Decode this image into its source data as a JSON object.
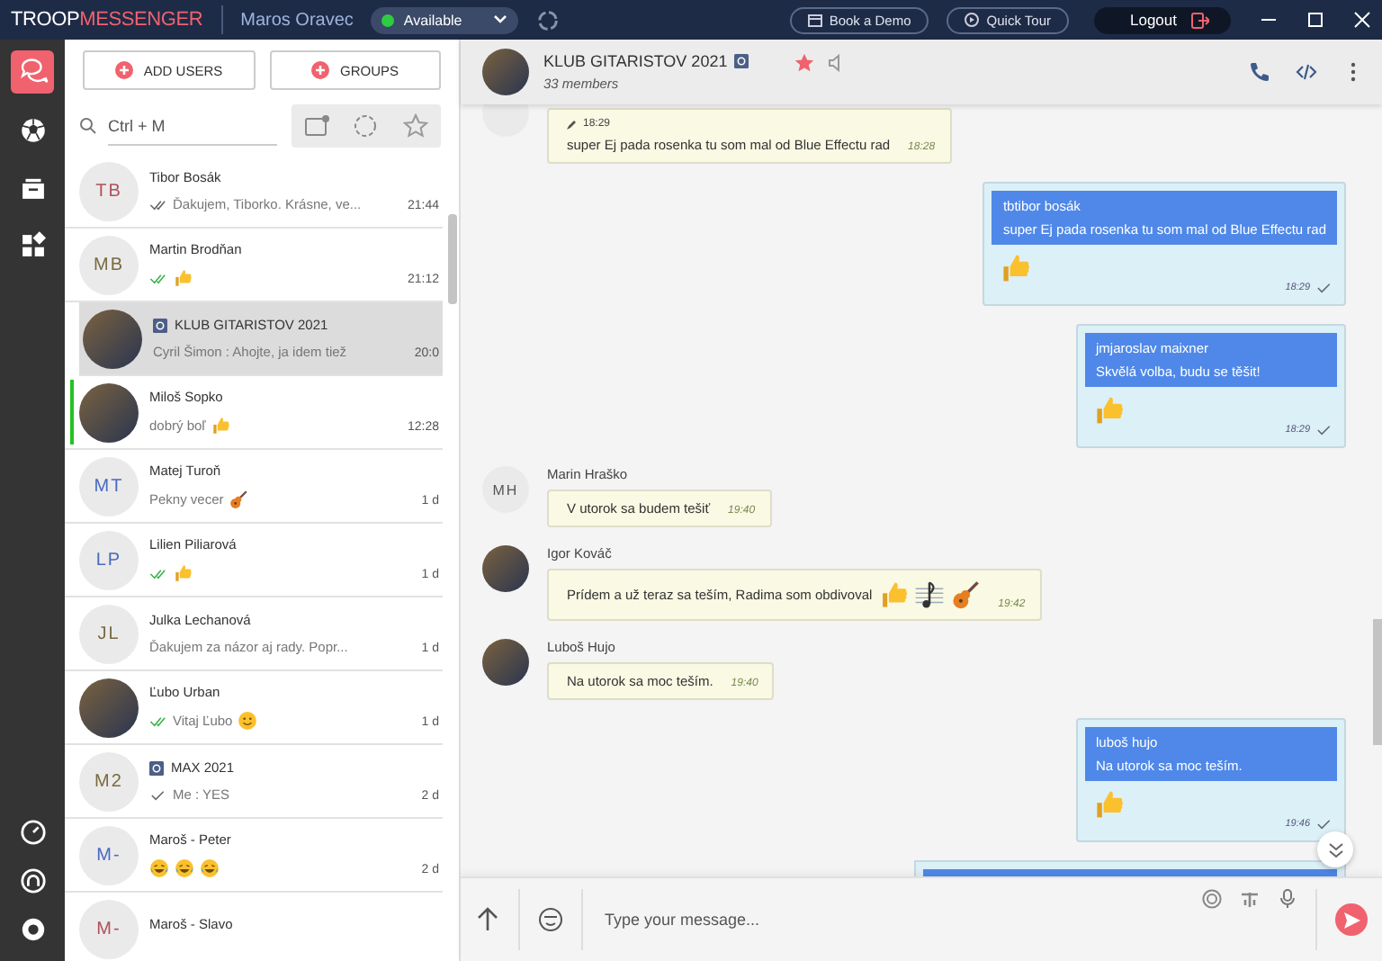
{
  "topbar": {
    "logo_a": "TROOP",
    "logo_b": "MESSENGER",
    "user": "Maros Oravec",
    "status": {
      "label": "Available",
      "color": "#2ecc40"
    },
    "buttons": [
      {
        "label": "Book a Demo",
        "kind": "calendar"
      },
      {
        "label": "Quick Tour",
        "kind": "play"
      }
    ],
    "logout": "Logout"
  },
  "rail": {
    "items": [
      {
        "kind": "chat",
        "selected": true
      },
      {
        "kind": "ball",
        "selected": false
      },
      {
        "kind": "files",
        "selected": false
      },
      {
        "kind": "apps",
        "selected": false
      }
    ]
  },
  "contacts_panel": {
    "add_users": "ADD USERS",
    "groups": "GROUPS",
    "search": {
      "placeholder": "Ctrl + M"
    },
    "contacts": [
      {
        "kind": "initials",
        "initials": "TB",
        "color": "#b0505a",
        "name": "Tibor Bosák",
        "group": false,
        "double_check": true,
        "read": false,
        "preview": "Ďakujem, Tiborko. Krásne, ve...",
        "time": "21:44",
        "selected": false,
        "online": false
      },
      {
        "kind": "initials",
        "initials": "MB",
        "color": "#7a6a40",
        "name": "Martin Brodňan",
        "group": false,
        "double_check": true,
        "read": true,
        "emojis": [
          {
            "kind": "thumb"
          }
        ],
        "time": "21:12",
        "selected": false,
        "online": false
      },
      {
        "kind": "photo",
        "name": "KLUB GITARISTOV 2021",
        "group": true,
        "preview": "Cyril Šimon : Ahojte, ja idem tiež",
        "time": "20:0",
        "selected": true,
        "online": false
      },
      {
        "kind": "photo",
        "name": "Miloš Sopko",
        "group": false,
        "preview": "dobrý boľ",
        "emojis": [
          {
            "kind": "thumb"
          }
        ],
        "time": "12:28",
        "selected": false,
        "online": true
      },
      {
        "kind": "initials",
        "initials": "MT",
        "color": "#4a6ac0",
        "name": "Matej Turoň",
        "group": false,
        "preview": "Pekny vecer",
        "emojis": [
          {
            "kind": "guitar"
          }
        ],
        "time": "1 d",
        "selected": false,
        "online": false
      },
      {
        "kind": "initials",
        "initials": "LP",
        "color": "#4a6ac0",
        "name": "Lilien Piliarová",
        "group": false,
        "double_check": true,
        "read": true,
        "emojis": [
          {
            "kind": "thumb"
          }
        ],
        "time": "1 d",
        "selected": false,
        "online": false
      },
      {
        "kind": "initials",
        "initials": "JL",
        "color": "#7a6a40",
        "name": "Julka Lechanová",
        "group": false,
        "preview": "Ďakujem za názor aj rady. Popr...",
        "time": "1 d",
        "selected": false,
        "online": false
      },
      {
        "kind": "photo",
        "name": "Ľubo Urban",
        "group": false,
        "double_check": true,
        "read": true,
        "preview": "Vitaj Ľubo",
        "emojis": [
          {
            "kind": "smile"
          }
        ],
        "time": "1 d",
        "selected": false,
        "online": false
      },
      {
        "kind": "initials",
        "initials": "M2",
        "color": "#7a6a40",
        "name": "MAX 2021",
        "group": true,
        "double_check": false,
        "read": false,
        "preview": "Me :  YES",
        "time": "2 d",
        "selected": false,
        "online": false
      },
      {
        "kind": "initials",
        "initials": "M-",
        "color": "#4a6ac0",
        "name": "Maroš - Peter",
        "group": false,
        "emojis": [
          {
            "kind": "laugh"
          },
          {
            "kind": "laugh"
          },
          {
            "kind": "laugh"
          }
        ],
        "time": "2 d",
        "selected": false,
        "online": false
      },
      {
        "kind": "initials",
        "initials": "M-",
        "color": "#b0505a",
        "name": "Maroš - Slavo",
        "group": false,
        "selected": false,
        "online": false
      }
    ]
  },
  "chat": {
    "title": "KLUB GITARISTOV 2021",
    "group": true,
    "members": "33 members",
    "starred": true,
    "messages": [
      {
        "kind": "incoming",
        "avatar": {
          "kind": "blank"
        },
        "edited": "18:29",
        "text": "super Ej pada rosenka tu som mal od Blue Effectu rad",
        "time": "18:28"
      },
      {
        "kind": "outgoing",
        "quote_author": "tbtibor bosák",
        "quote_text": "super Ej pada rosenka tu som mal od Blue Effectu rad",
        "emojis": [
          {
            "kind": "thumb"
          }
        ],
        "time": "18:29"
      },
      {
        "kind": "outgoing",
        "quote_author": "jmjaroslav maixner",
        "quote_text": "Skvělá volba, budu se těšit!",
        "emojis": [
          {
            "kind": "thumb"
          }
        ],
        "time": "18:29"
      },
      {
        "kind": "incoming",
        "avatar": {
          "kind": "initials",
          "initials": "MH"
        },
        "sender": "Marin Hraško",
        "text": "V utorok sa budem tešiť",
        "time": "19:40"
      },
      {
        "kind": "incoming",
        "avatar": {
          "kind": "photo"
        },
        "sender": "Igor Kováč",
        "text": "Prídem a už teraz sa teším, Radima som obdivoval",
        "emojis": [
          {
            "kind": "thumb"
          },
          {
            "kind": "music"
          },
          {
            "kind": "guitar"
          }
        ],
        "time": "19:42"
      },
      {
        "kind": "incoming",
        "avatar": {
          "kind": "photo"
        },
        "sender": "Luboš Hujo",
        "text": "Na utorok sa moc teším.",
        "time": "19:40"
      },
      {
        "kind": "outgoing",
        "quote_author": "luboš hujo",
        "quote_text": "Na utorok sa moc teším.",
        "emojis": [
          {
            "kind": "thumb"
          }
        ],
        "time": "19:46"
      },
      {
        "kind": "partial"
      }
    ],
    "composer": {
      "placeholder": "Type your message..."
    }
  }
}
